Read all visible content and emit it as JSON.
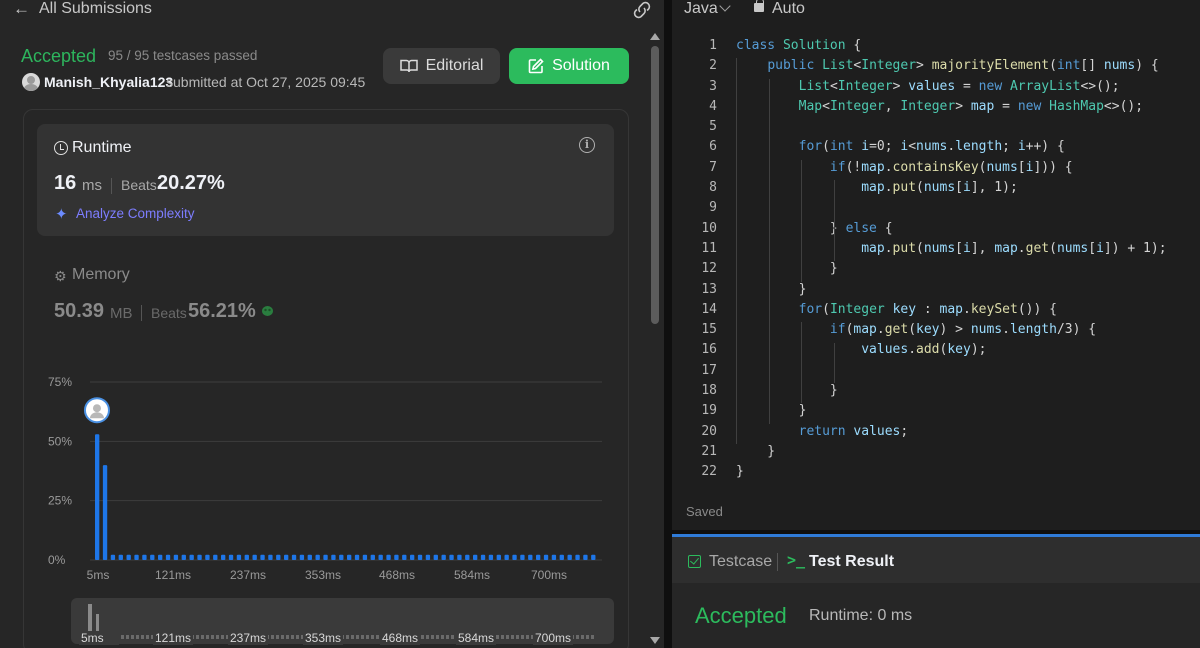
{
  "header": {
    "back_label": "All Submissions"
  },
  "submission": {
    "status": "Accepted",
    "testcases": "95 / 95 testcases passed",
    "username": "Manish_Khyalia123",
    "submitted_at": "submitted at Oct 27, 2025 09:45"
  },
  "buttons": {
    "editorial": "Editorial",
    "solution": "Solution"
  },
  "runtime": {
    "label": "Runtime",
    "value": "16",
    "unit": "ms",
    "beats_label": "Beats",
    "beats_value": "20.27%",
    "analyze": "Analyze Complexity"
  },
  "memory": {
    "label": "Memory",
    "value": "50.39",
    "unit": "MB",
    "beats_label": "Beats",
    "beats_value": "56.21%"
  },
  "chart_data": {
    "type": "bar",
    "x_ticks": [
      "5ms",
      "121ms",
      "237ms",
      "353ms",
      "468ms",
      "584ms",
      "700ms"
    ],
    "y_ticks": [
      "75%",
      "50%",
      "25%",
      "0%"
    ],
    "ylim": [
      0,
      75
    ],
    "grid": true,
    "values": [
      53,
      40,
      2.2,
      2.2,
      2.2,
      2.2,
      2.2,
      2.2,
      2.2,
      2.2,
      2.2,
      2.2,
      2.2,
      2.2,
      2.2,
      2.2,
      2.2,
      2.2,
      2.2,
      2.2,
      2.2,
      2.2,
      2.2,
      2.2,
      2.2,
      2.2,
      2.2,
      2.2,
      2.2,
      2.2,
      2.2,
      2.2,
      2.2,
      2.2,
      2.2,
      2.2,
      2.2,
      2.2,
      2.2,
      2.2,
      2.2,
      2.2,
      2.2,
      2.2,
      2.2,
      2.2,
      2.2,
      2.2,
      2.2,
      2.2,
      2.2,
      2.2,
      2.2,
      2.2,
      2.2,
      2.2,
      2.2,
      2.2,
      2.2,
      2.2,
      2.2,
      2.2,
      2.2,
      2.2
    ],
    "highlight_index": 0,
    "colors": {
      "bar": "#1e76e8",
      "grid": "#3e3e3e",
      "axis_text": "#9a9a9a"
    }
  },
  "editor": {
    "language": "Java",
    "mode": "Auto",
    "saved": "Saved",
    "lines": [
      "class Solution {",
      "    public List<Integer> majorityElement(int[] nums) {",
      "        List<Integer> values = new ArrayList<>();",
      "        Map<Integer, Integer> map = new HashMap<>();",
      "",
      "        for(int i=0; i<nums.length; i++) {",
      "            if(!map.containsKey(nums[i])) {",
      "                map.put(nums[i], 1);",
      "",
      "            } else {",
      "                map.put(nums[i], map.get(nums[i]) + 1);",
      "            }",
      "        }",
      "        for(Integer key : map.keySet()) {",
      "            if(map.get(key) > nums.length/3) {",
      "                values.add(key);",
      "",
      "            }",
      "        }",
      "        return values;",
      "    }",
      "}"
    ],
    "colors": {
      "keyword": "#569cd6",
      "type": "#4ec9b0",
      "variable": "#9cdcfe",
      "method": "#dcdcaa",
      "plain": "#d4d4d4"
    }
  },
  "bottom": {
    "testcase_tab": "Testcase",
    "result_tab": "Test Result",
    "result_status": "Accepted",
    "result_runtime": "Runtime: 0 ms"
  }
}
